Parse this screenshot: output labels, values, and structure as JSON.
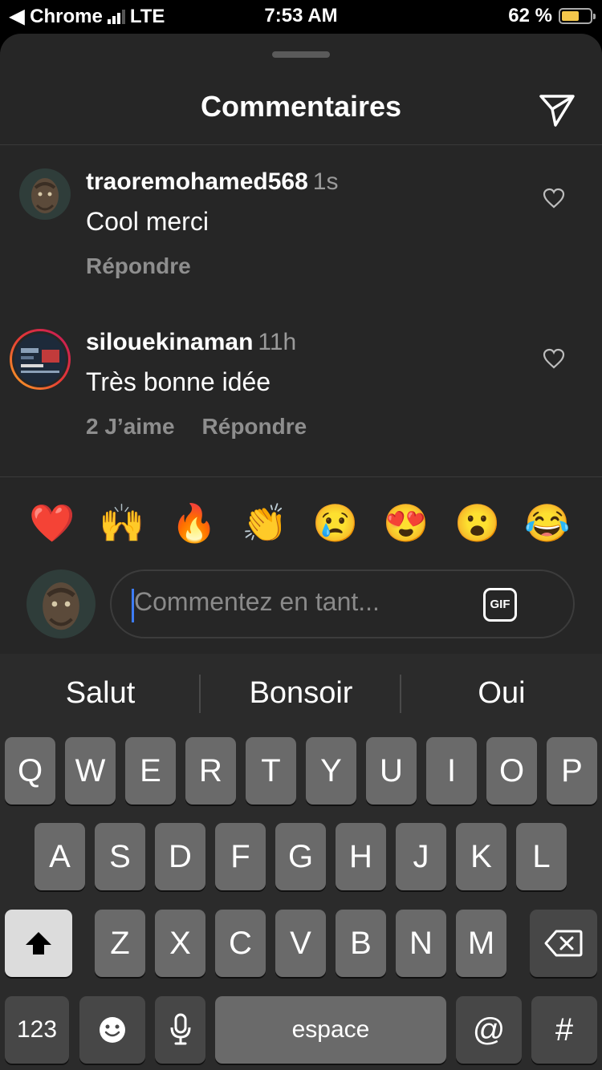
{
  "statusbar": {
    "back_app": "◀ Chrome",
    "network": "LTE",
    "time": "7:53 AM",
    "battery_text": "62 %",
    "battery_level": 0.62
  },
  "sheet": {
    "title": "Commentaires"
  },
  "comments": [
    {
      "username": "traoremohamed568",
      "time": "1s",
      "text": "Cool merci",
      "likes": "",
      "reply": "Répondre"
    },
    {
      "username": "silouekinaman",
      "time": "11h",
      "text": "Très bonne idée",
      "likes": "2 J’aime",
      "reply": "Répondre"
    }
  ],
  "emojis": [
    "❤️",
    "🙌",
    "🔥",
    "👏",
    "😢",
    "😍",
    "😮",
    "😂"
  ],
  "composer": {
    "placeholder": "Commentez en tant...",
    "gif_label": "GIF"
  },
  "keyboard": {
    "suggestions": [
      "Salut",
      "Bonsoir",
      "Oui"
    ],
    "row1": [
      "Q",
      "W",
      "E",
      "R",
      "T",
      "Y",
      "U",
      "I",
      "O",
      "P"
    ],
    "row2": [
      "A",
      "S",
      "D",
      "F",
      "G",
      "H",
      "J",
      "K",
      "L"
    ],
    "row3": [
      "Z",
      "X",
      "C",
      "V",
      "B",
      "N",
      "M"
    ],
    "numbers_label": "123",
    "space_label": "espace",
    "at_label": "@",
    "hash_label": "#"
  },
  "colors": {
    "sheet_bg": "#262626",
    "caret": "#3d7cf5",
    "battery": "#f5c84b",
    "story_ring_start": "#f9a825",
    "story_ring_end": "#c2185b"
  }
}
